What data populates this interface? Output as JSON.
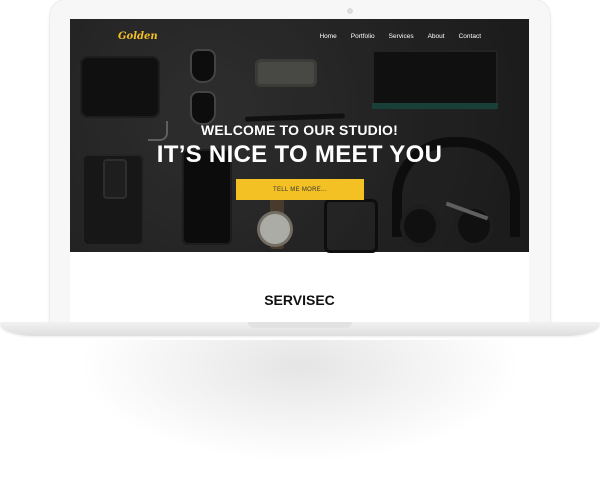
{
  "site": {
    "logo": "Golden",
    "accent_color": "#f4c125",
    "nav": [
      {
        "label": "Home"
      },
      {
        "label": "Portfolio"
      },
      {
        "label": "Services"
      },
      {
        "label": "About"
      },
      {
        "label": "Contact"
      }
    ]
  },
  "hero": {
    "subheading": "WELCOME TO OUR STUDIO!",
    "heading": "IT’S NICE TO MEET YOU",
    "cta_label": "TELL ME MORE..."
  },
  "sections": {
    "services_title": "SERVISEC"
  }
}
